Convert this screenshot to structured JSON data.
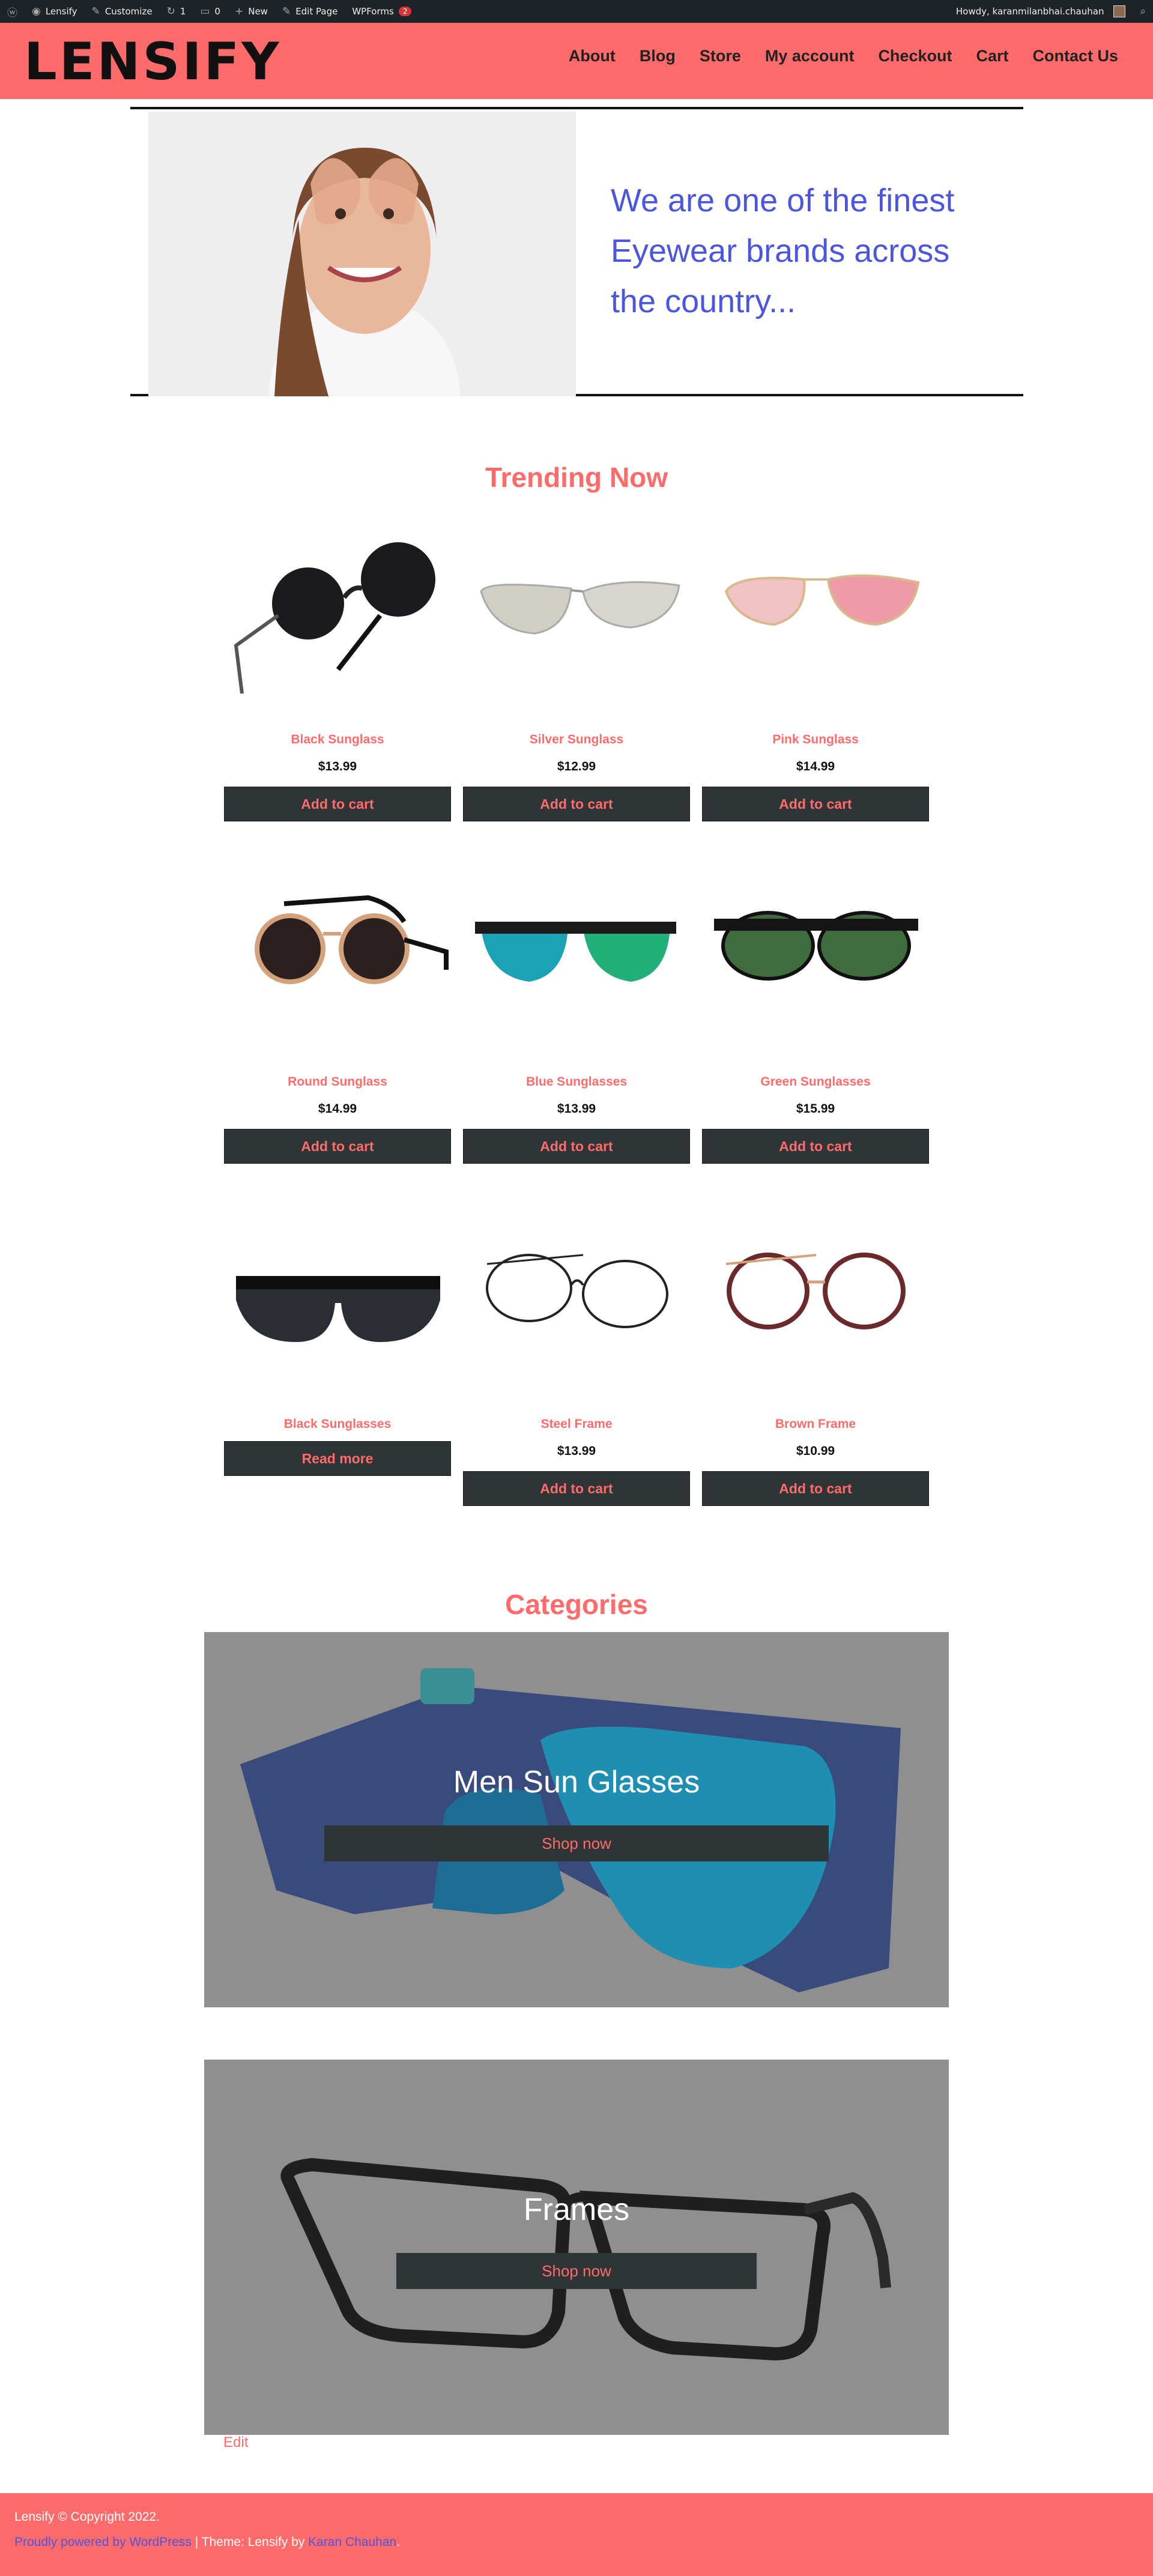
{
  "admin_bar": {
    "site_name": "Lensify",
    "customize": "Customize",
    "updates_count": "1",
    "comments_count": "0",
    "new": "New",
    "edit_page": "Edit Page",
    "wpforms": "WPForms",
    "wpforms_badge": "2",
    "howdy": "Howdy, karanmilanbhai.chauhan"
  },
  "header": {
    "logo": "LENSIFY",
    "nav": [
      "About",
      "Blog",
      "Store",
      "My account",
      "Checkout",
      "Cart",
      "Contact Us"
    ],
    "background": "#ff6b6b"
  },
  "hero": {
    "tagline": "We are one of the finest Eyewear brands across the country..."
  },
  "trending": {
    "title": "Trending Now",
    "products": [
      {
        "name": "Black Sunglass",
        "price": "$13.99",
        "button": "Add to cart"
      },
      {
        "name": "Silver Sunglass",
        "price": "$12.99",
        "button": "Add to cart"
      },
      {
        "name": "Pink Sunglass",
        "price": "$14.99",
        "button": "Add to cart"
      },
      {
        "name": "Round Sunglass",
        "price": "$14.99",
        "button": "Add to cart"
      },
      {
        "name": "Blue Sunglasses",
        "price": "$13.99",
        "button": "Add to cart"
      },
      {
        "name": "Green Sunglasses",
        "price": "$15.99",
        "button": "Add to cart"
      },
      {
        "name": "Black Sunglasses",
        "price": "",
        "button": "Read more"
      },
      {
        "name": "Steel Frame",
        "price": "$13.99",
        "button": "Add to cart"
      },
      {
        "name": "Brown Frame",
        "price": "$10.99",
        "button": "Add to cart"
      }
    ]
  },
  "categories": {
    "title": "Categories",
    "items": [
      {
        "title": "Men Sun Glasses",
        "button": "Shop now"
      },
      {
        "title": "Frames",
        "button": "Shop now"
      }
    ]
  },
  "edit_link": "Edit",
  "footer": {
    "copyright": "Lensify © Copyright 2022.",
    "powered": "Proudly powered by WordPress",
    "theme_sep": " | Theme: Lensify by ",
    "author": "Karan Chauhan",
    "end": "."
  }
}
